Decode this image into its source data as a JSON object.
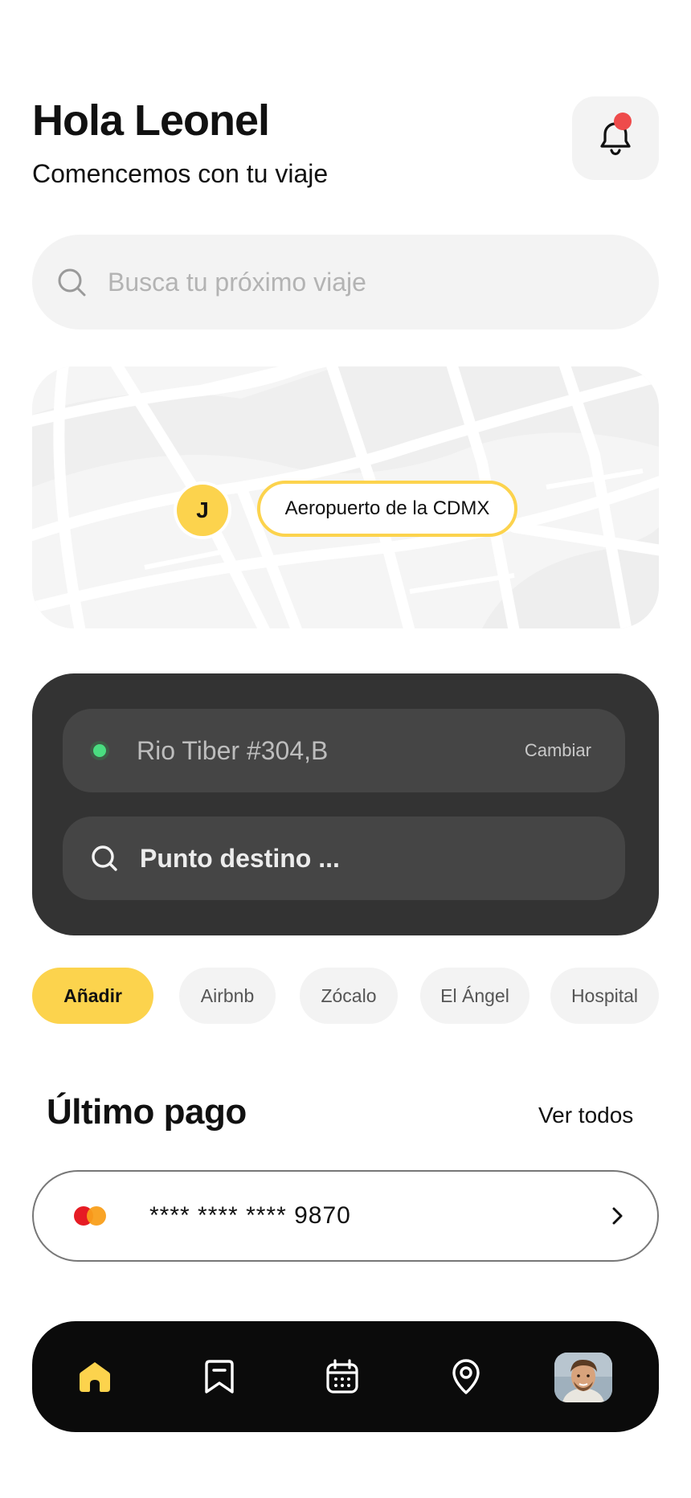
{
  "header": {
    "greeting": "Hola Leonel",
    "subtitle": "Comencemos con tu viaje",
    "notification_icon": "bell-icon"
  },
  "search": {
    "placeholder": "Busca tu próximo viaje",
    "icon": "search-icon"
  },
  "map": {
    "driver_initial": "J",
    "destination_tag": "Aeropuerto de la CDMX"
  },
  "route": {
    "origin": "Rio Tiber #304,B",
    "change_label": "Cambiar",
    "destination_placeholder": "Punto destino ..."
  },
  "chips": [
    {
      "label": "Añadir",
      "active": true
    },
    {
      "label": "Airbnb",
      "active": false
    },
    {
      "label": "Zócalo",
      "active": false
    },
    {
      "label": "El Ángel",
      "active": false
    },
    {
      "label": "Hospital",
      "active": false
    }
  ],
  "payments": {
    "title": "Último pago",
    "see_all": "Ver todos",
    "card_number": "**** **** **** 9870",
    "card_brand_icon": "mastercard-icon"
  },
  "nav": {
    "items": [
      "home-icon",
      "bookmark-icon",
      "calendar-icon",
      "location-pin-icon",
      "profile-avatar"
    ],
    "active": "home-icon"
  },
  "colors": {
    "accent": "#fcd34d",
    "dark_panel": "#333333",
    "nav_bg": "#0b0b0b",
    "notification_dot": "#ee4b4b",
    "origin_dot": "#4ade80"
  }
}
